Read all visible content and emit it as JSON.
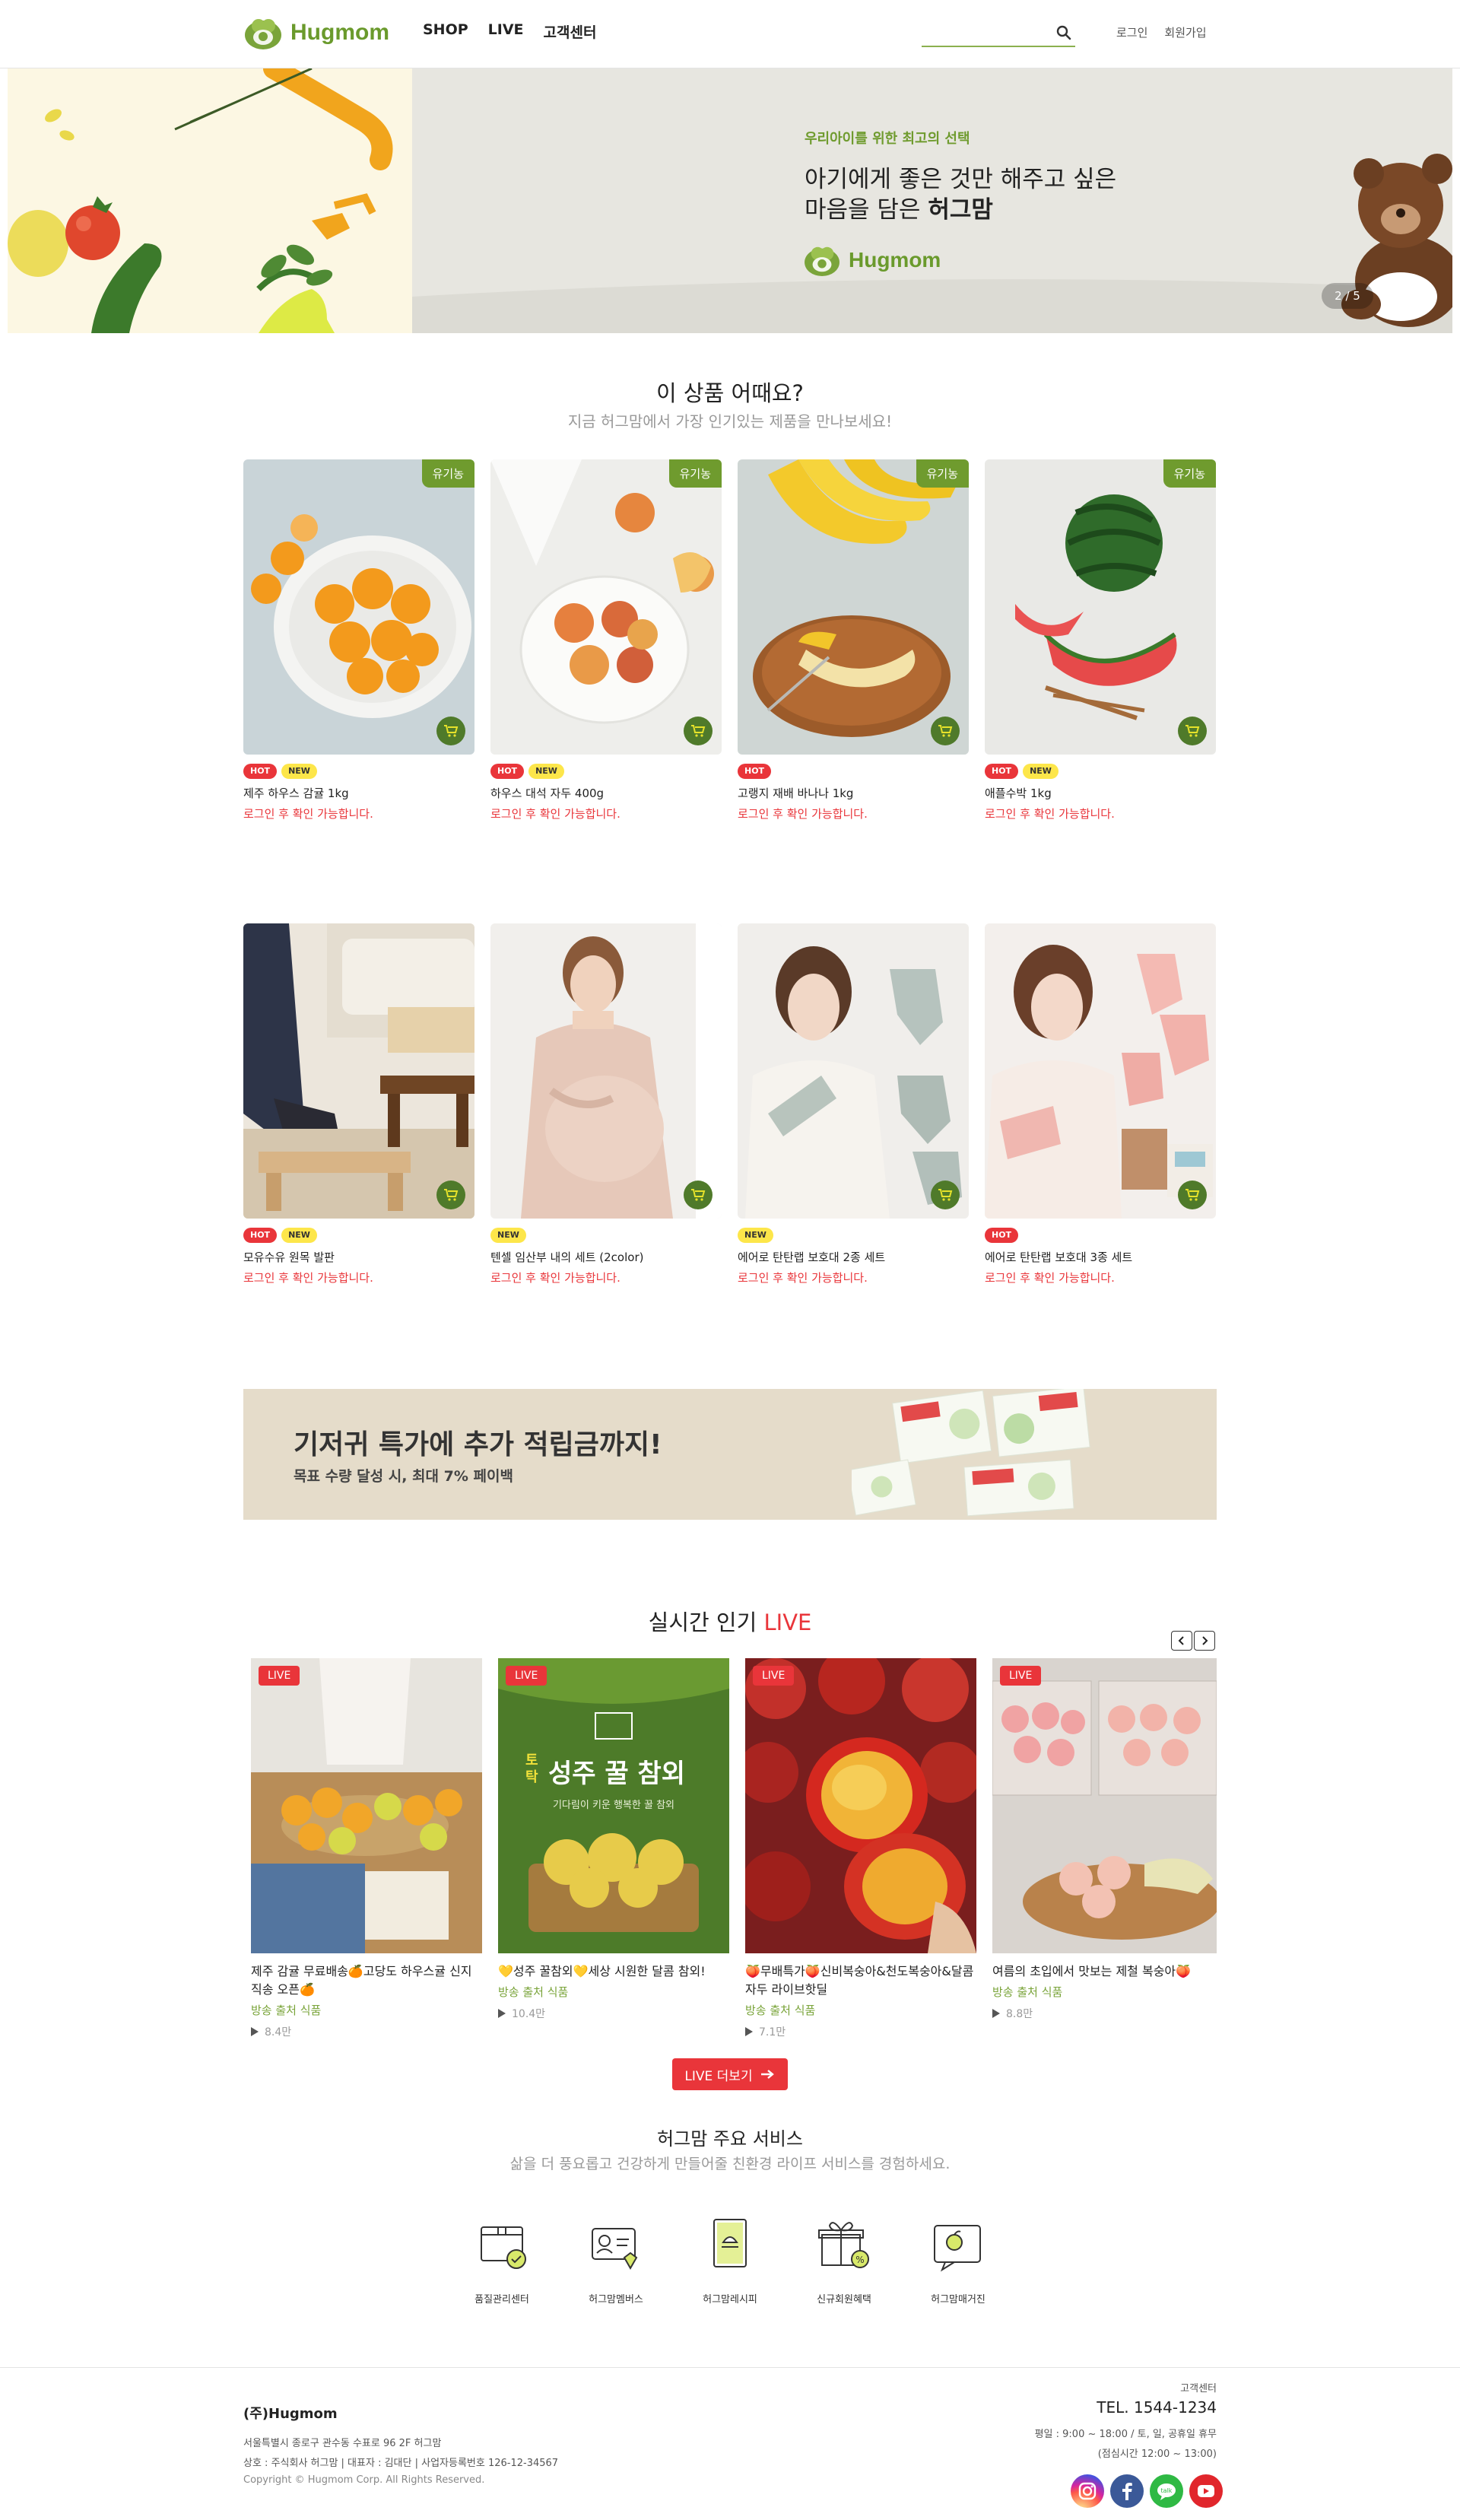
{
  "header": {
    "logo_text": "Hugmom",
    "nav": [
      "SHOP",
      "LIVE",
      "고객센터"
    ],
    "search_placeholder": "",
    "login": "로그인",
    "signup": "회원가입"
  },
  "hero": {
    "sub": "우리아이를 위한 최고의 선택",
    "line1": "아기에게 좋은 것만 해주고 싶은",
    "line2_prefix": "마음을 담은 ",
    "line2_bold": "허그맘",
    "logo_text": "Hugmom",
    "pager": "2 / 5"
  },
  "products_section": {
    "title": "이 상품 어때요?",
    "subtitle": "지금 허그맘에서 가장 인기있는 제품을 만나보세요!"
  },
  "products": [
    {
      "name": "제주 하우스 감귤 1kg",
      "price": "로그인 후 확인 가능합니다.",
      "organic": "유기농",
      "hot": "HOT",
      "new": "NEW"
    },
    {
      "name": "하우스 대석 자두 400g",
      "price": "로그인 후 확인 가능합니다.",
      "organic": "유기농",
      "hot": "HOT",
      "new": "NEW"
    },
    {
      "name": "고랭지 재배 바나나 1kg",
      "price": "로그인 후 확인 가능합니다.",
      "organic": "유기농",
      "hot": "HOT"
    },
    {
      "name": "애플수박 1kg",
      "price": "로그인 후 확인 가능합니다.",
      "organic": "유기농",
      "hot": "HOT",
      "new": "NEW"
    },
    {
      "name": "모유수유 원목 발판",
      "price": "로그인 후 확인 가능합니다.",
      "hot": "HOT",
      "new": "NEW"
    },
    {
      "name": "텐셀 임산부 내의 세트 (2color)",
      "price": "로그인 후 확인 가능합니다.",
      "new": "NEW"
    },
    {
      "name": "에어로 탄탄랩 보호대 2종 세트",
      "price": "로그인 후 확인 가능합니다.",
      "new": "NEW"
    },
    {
      "name": "에어로 탄탄랩 보호대 3종 세트",
      "price": "로그인 후 확인 가능합니다.",
      "hot": "HOT"
    }
  ],
  "promo": {
    "title": "기저귀 특가에 추가 적립금까지!",
    "subtitle": "목표 수량 달성 시, 최대 7% 페이백"
  },
  "live_section": {
    "title_prefix": "실시간 인기 ",
    "title_accent": "LIVE",
    "more_button": "LIVE 더보기"
  },
  "live_items": [
    {
      "badge": "LIVE",
      "title": "제주 감귤 무료배송🍊고당도 하우스귤 신지직송 오픈🍊",
      "category": "방송 출처 식품",
      "views": "8.4만"
    },
    {
      "badge": "LIVE",
      "title": "💛성주 꿀참외💛세상 시원한 달콤 참외!",
      "category": "방송 출처 식품",
      "views": "10.4만",
      "poster_tag": "토탁",
      "poster_title": "성주 꿀 참외",
      "poster_sub": "기다림이 키운 행복한 꿀 참외"
    },
    {
      "badge": "LIVE",
      "title": "🍑무배특가🍑신비복숭아&천도복숭아&달콤자두 라이브핫딜",
      "category": "방송 출처 식품",
      "views": "7.1만"
    },
    {
      "badge": "LIVE",
      "title": "여름의 초입에서 맛보는 제철 복숭아🍑",
      "category": "방송 출처 식품",
      "views": "8.8만"
    }
  ],
  "services_section": {
    "title": "허그맘 주요 서비스",
    "subtitle": "삶을 더 풍요롭고 건강하게 만들어줄 친환경 라이프 서비스를 경험하세요."
  },
  "services": [
    {
      "label": "품질관리센터",
      "icon": "box-check-icon"
    },
    {
      "label": "허그맘멤버스",
      "icon": "member-card-icon"
    },
    {
      "label": "허그맘레시피",
      "icon": "recipe-book-icon"
    },
    {
      "label": "신규회원혜택",
      "icon": "gift-icon"
    },
    {
      "label": "허그맘매거진",
      "icon": "magazine-icon"
    }
  ],
  "footer": {
    "company": "(주)Hugmom",
    "address": "서울특별시 종로구 관수동 수표로 96 2F 허그맘",
    "biz": "상호 : 주식회사 허그맘 | 대표자 : 김대단 | 사업자등록번호 126-12-34567",
    "copyright": "Copyright © Hugmom Corp. All Rights Reserved.",
    "cs_label": "고객센터",
    "tel": "TEL. 1544-1234",
    "hours": "평일 : 9:00 ~ 18:00 / 토, 일, 공휴일 휴무",
    "lunch": "(점심시간 12:00 ~ 13:00)",
    "sns": [
      "instagram-icon",
      "facebook-icon",
      "talk-icon",
      "youtube-icon"
    ]
  },
  "colors": {
    "brand": "#6a9a2c",
    "accent_red": "#e9353a",
    "new_yellow": "#fde64a"
  }
}
